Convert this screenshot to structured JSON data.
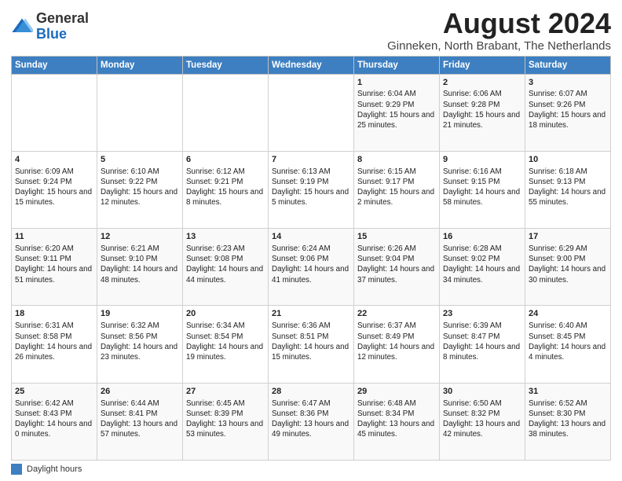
{
  "header": {
    "logo": {
      "general": "General",
      "blue": "Blue"
    },
    "title": "August 2024",
    "subtitle": "Ginneken, North Brabant, The Netherlands"
  },
  "calendar": {
    "days_of_week": [
      "Sunday",
      "Monday",
      "Tuesday",
      "Wednesday",
      "Thursday",
      "Friday",
      "Saturday"
    ],
    "weeks": [
      [
        {
          "day": "",
          "info": ""
        },
        {
          "day": "",
          "info": ""
        },
        {
          "day": "",
          "info": ""
        },
        {
          "day": "",
          "info": ""
        },
        {
          "day": "1",
          "info": "Sunrise: 6:04 AM\nSunset: 9:29 PM\nDaylight: 15 hours and 25 minutes."
        },
        {
          "day": "2",
          "info": "Sunrise: 6:06 AM\nSunset: 9:28 PM\nDaylight: 15 hours and 21 minutes."
        },
        {
          "day": "3",
          "info": "Sunrise: 6:07 AM\nSunset: 9:26 PM\nDaylight: 15 hours and 18 minutes."
        }
      ],
      [
        {
          "day": "4",
          "info": "Sunrise: 6:09 AM\nSunset: 9:24 PM\nDaylight: 15 hours and 15 minutes."
        },
        {
          "day": "5",
          "info": "Sunrise: 6:10 AM\nSunset: 9:22 PM\nDaylight: 15 hours and 12 minutes."
        },
        {
          "day": "6",
          "info": "Sunrise: 6:12 AM\nSunset: 9:21 PM\nDaylight: 15 hours and 8 minutes."
        },
        {
          "day": "7",
          "info": "Sunrise: 6:13 AM\nSunset: 9:19 PM\nDaylight: 15 hours and 5 minutes."
        },
        {
          "day": "8",
          "info": "Sunrise: 6:15 AM\nSunset: 9:17 PM\nDaylight: 15 hours and 2 minutes."
        },
        {
          "day": "9",
          "info": "Sunrise: 6:16 AM\nSunset: 9:15 PM\nDaylight: 14 hours and 58 minutes."
        },
        {
          "day": "10",
          "info": "Sunrise: 6:18 AM\nSunset: 9:13 PM\nDaylight: 14 hours and 55 minutes."
        }
      ],
      [
        {
          "day": "11",
          "info": "Sunrise: 6:20 AM\nSunset: 9:11 PM\nDaylight: 14 hours and 51 minutes."
        },
        {
          "day": "12",
          "info": "Sunrise: 6:21 AM\nSunset: 9:10 PM\nDaylight: 14 hours and 48 minutes."
        },
        {
          "day": "13",
          "info": "Sunrise: 6:23 AM\nSunset: 9:08 PM\nDaylight: 14 hours and 44 minutes."
        },
        {
          "day": "14",
          "info": "Sunrise: 6:24 AM\nSunset: 9:06 PM\nDaylight: 14 hours and 41 minutes."
        },
        {
          "day": "15",
          "info": "Sunrise: 6:26 AM\nSunset: 9:04 PM\nDaylight: 14 hours and 37 minutes."
        },
        {
          "day": "16",
          "info": "Sunrise: 6:28 AM\nSunset: 9:02 PM\nDaylight: 14 hours and 34 minutes."
        },
        {
          "day": "17",
          "info": "Sunrise: 6:29 AM\nSunset: 9:00 PM\nDaylight: 14 hours and 30 minutes."
        }
      ],
      [
        {
          "day": "18",
          "info": "Sunrise: 6:31 AM\nSunset: 8:58 PM\nDaylight: 14 hours and 26 minutes."
        },
        {
          "day": "19",
          "info": "Sunrise: 6:32 AM\nSunset: 8:56 PM\nDaylight: 14 hours and 23 minutes."
        },
        {
          "day": "20",
          "info": "Sunrise: 6:34 AM\nSunset: 8:54 PM\nDaylight: 14 hours and 19 minutes."
        },
        {
          "day": "21",
          "info": "Sunrise: 6:36 AM\nSunset: 8:51 PM\nDaylight: 14 hours and 15 minutes."
        },
        {
          "day": "22",
          "info": "Sunrise: 6:37 AM\nSunset: 8:49 PM\nDaylight: 14 hours and 12 minutes."
        },
        {
          "day": "23",
          "info": "Sunrise: 6:39 AM\nSunset: 8:47 PM\nDaylight: 14 hours and 8 minutes."
        },
        {
          "day": "24",
          "info": "Sunrise: 6:40 AM\nSunset: 8:45 PM\nDaylight: 14 hours and 4 minutes."
        }
      ],
      [
        {
          "day": "25",
          "info": "Sunrise: 6:42 AM\nSunset: 8:43 PM\nDaylight: 14 hours and 0 minutes."
        },
        {
          "day": "26",
          "info": "Sunrise: 6:44 AM\nSunset: 8:41 PM\nDaylight: 13 hours and 57 minutes."
        },
        {
          "day": "27",
          "info": "Sunrise: 6:45 AM\nSunset: 8:39 PM\nDaylight: 13 hours and 53 minutes."
        },
        {
          "day": "28",
          "info": "Sunrise: 6:47 AM\nSunset: 8:36 PM\nDaylight: 13 hours and 49 minutes."
        },
        {
          "day": "29",
          "info": "Sunrise: 6:48 AM\nSunset: 8:34 PM\nDaylight: 13 hours and 45 minutes."
        },
        {
          "day": "30",
          "info": "Sunrise: 6:50 AM\nSunset: 8:32 PM\nDaylight: 13 hours and 42 minutes."
        },
        {
          "day": "31",
          "info": "Sunrise: 6:52 AM\nSunset: 8:30 PM\nDaylight: 13 hours and 38 minutes."
        }
      ]
    ]
  },
  "legend": {
    "label": "Daylight hours"
  }
}
